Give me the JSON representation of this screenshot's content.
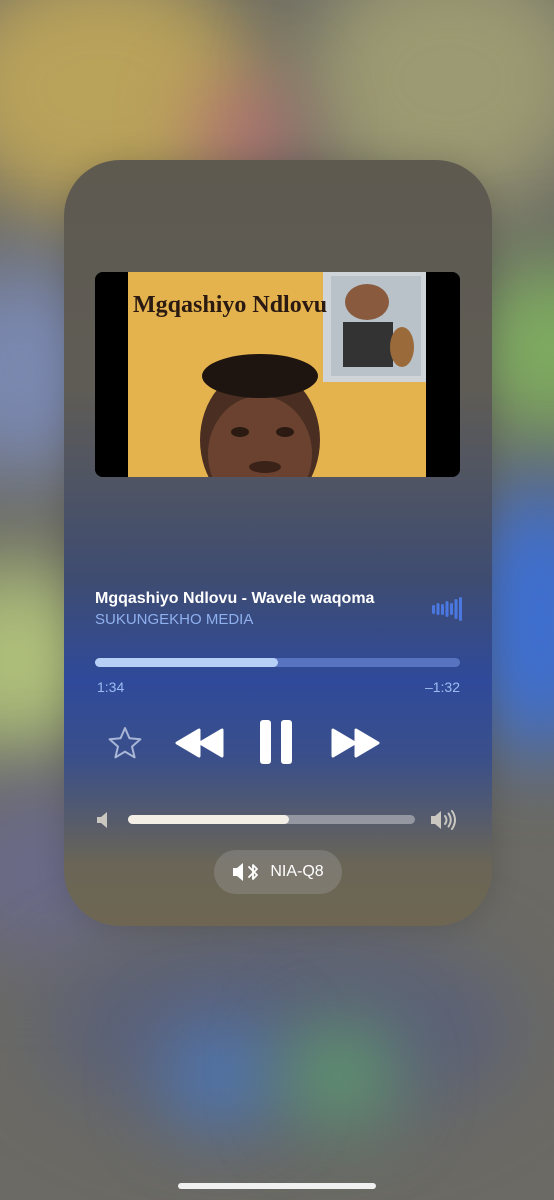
{
  "now_playing": {
    "album_art_text": "Mgqashiyo Ndlovu",
    "title": "Mgqashiyo Ndlovu - Wavele waqoma",
    "artist": "SUKUNGEKHO MEDIA",
    "progress": 0.5,
    "elapsed": "1:34",
    "remaining": "–1:32",
    "volume": 0.56
  },
  "controls": {
    "favorite_icon": "star-icon",
    "rewind_icon": "rewind-icon",
    "pause_icon": "pause-icon",
    "forward_icon": "fast-forward-icon"
  },
  "output": {
    "device_name": "NIA-Q8",
    "icon": "bluetooth-speaker-icon"
  },
  "colors": {
    "accent": "#4b78e0",
    "subtitle": "#8fb0ee"
  }
}
